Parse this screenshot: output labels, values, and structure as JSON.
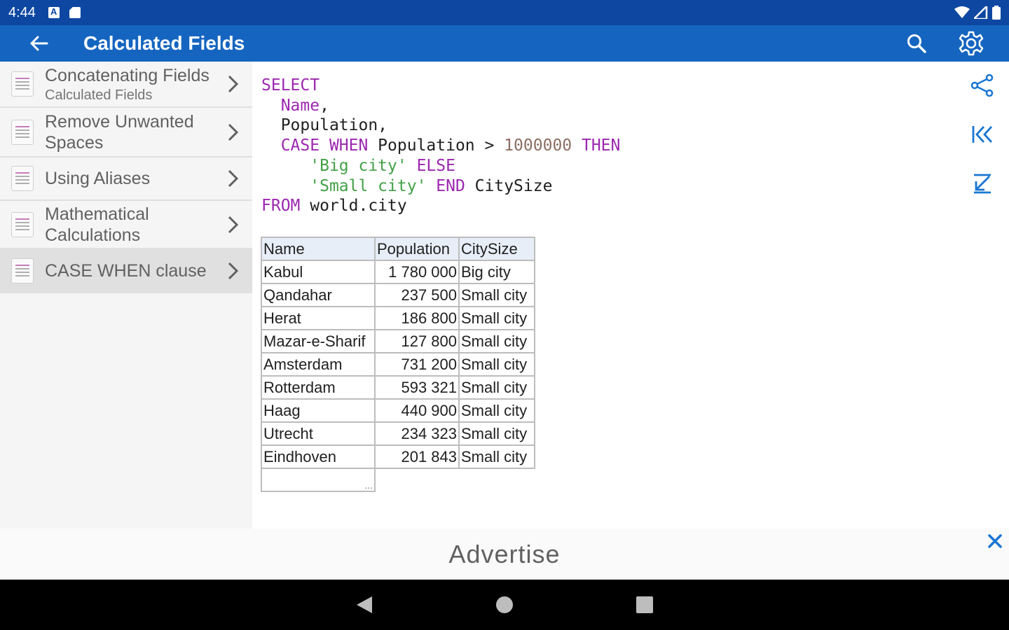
{
  "status_bar": {
    "time": "4:44"
  },
  "app_bar": {
    "title": "Calculated Fields",
    "back_icon": "arrow-left-icon",
    "actions": [
      "search-icon",
      "gear-icon"
    ]
  },
  "sidebar": {
    "items": [
      {
        "title": "Concatenating Fields",
        "subtitle": "Calculated Fields",
        "active": false
      },
      {
        "title": "Remove Unwanted Spaces",
        "subtitle": "",
        "active": false
      },
      {
        "title": "Using Aliases",
        "subtitle": "",
        "active": false
      },
      {
        "title": "Mathematical Calculations",
        "subtitle": "",
        "active": false
      },
      {
        "title": "CASE WHEN clause",
        "subtitle": "",
        "active": true
      }
    ]
  },
  "code": {
    "line1_kw": "SELECT",
    "line2_field": "Name",
    "line2_punct": ",",
    "line3": "Population,",
    "line4_kw1": "CASE WHEN",
    "line4_mid": " Population > ",
    "line4_num": "1000000",
    "line4_kw2": " THEN",
    "line5_str": "'Big city'",
    "line5_kw": " ELSE",
    "line6_str": "'Small city'",
    "line6_kw": " END",
    "line6_rest": " CitySize",
    "line7_kw": "FROM",
    "line7_rest": " world.city"
  },
  "table": {
    "headers": [
      "Name",
      "Population",
      "CitySize"
    ],
    "rows": [
      [
        "Kabul",
        "1 780 000",
        "Big city"
      ],
      [
        "Qandahar",
        "237 500",
        "Small city"
      ],
      [
        "Herat",
        "186 800",
        "Small city"
      ],
      [
        "Mazar-e-Sharif",
        "127 800",
        "Small city"
      ],
      [
        "Amsterdam",
        "731 200",
        "Small city"
      ],
      [
        "Rotterdam",
        "593 321",
        "Small city"
      ],
      [
        "Haag",
        "440 900",
        "Small city"
      ],
      [
        "Utrecht",
        "234 323",
        "Small city"
      ],
      [
        "Eindhoven",
        "201 843",
        "Small city"
      ]
    ],
    "more": "..."
  },
  "tools": [
    "share-icon",
    "first-page-icon",
    "fit-icon"
  ],
  "ad": {
    "text": "Advertise"
  },
  "colors": {
    "status_bar": "#0d47a1",
    "app_bar": "#1565c0",
    "keyword": "#9c27b0",
    "string": "#43a047",
    "number": "#8d6e63",
    "accent": "#1976d2"
  }
}
